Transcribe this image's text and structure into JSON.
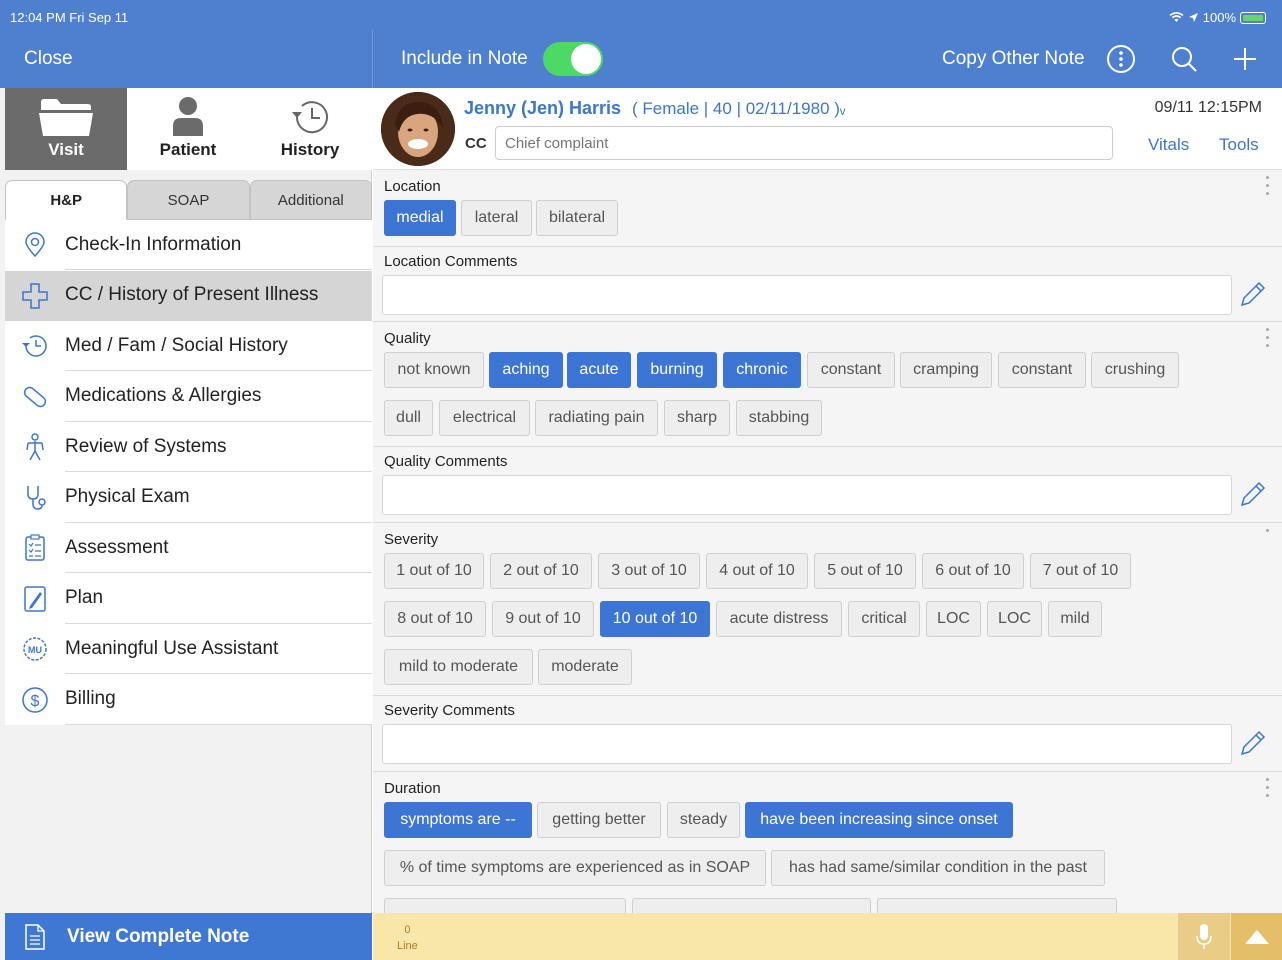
{
  "status": {
    "time": "12:04 PM  Fri Sep 11",
    "battery": "100%"
  },
  "topbar": {
    "close": "Close",
    "include_in_note": "Include in Note",
    "include_on": true,
    "copy_other_note": "Copy Other Note"
  },
  "sidebar": {
    "modes": [
      {
        "label": "Visit",
        "icon": "folder-icon",
        "active": true
      },
      {
        "label": "Patient",
        "icon": "person-icon",
        "active": false
      },
      {
        "label": "History",
        "icon": "history-icon",
        "active": false
      }
    ],
    "subtabs": [
      "H&P",
      "SOAP",
      "Additional"
    ],
    "items": [
      {
        "label": "Check-In Information",
        "icon": "location-pin-icon"
      },
      {
        "label": "CC / History of Present Illness",
        "icon": "medical-cross-icon",
        "active": true
      },
      {
        "label": "Med / Fam / Social History",
        "icon": "history-icon"
      },
      {
        "label": "Medications & Allergies",
        "icon": "pill-icon"
      },
      {
        "label": "Review of Systems",
        "icon": "body-icon"
      },
      {
        "label": "Physical Exam",
        "icon": "stethoscope-icon"
      },
      {
        "label": "Assessment",
        "icon": "clipboard-icon"
      },
      {
        "label": "Plan",
        "icon": "pen-note-icon"
      },
      {
        "label": "Meaningful Use Assistant",
        "icon": "mu-badge-icon"
      },
      {
        "label": "Billing",
        "icon": "dollar-icon"
      }
    ],
    "view_complete_note": "View Complete Note"
  },
  "patient": {
    "name": "Jenny (Jen) Harris",
    "info": "( Female | 40 | 02/11/1980 )ᵥ",
    "datetime": "09/11 12:15PM",
    "cc_label": "CC",
    "cc_placeholder": "Chief complaint",
    "vitals": "Vitals",
    "tools": "Tools"
  },
  "sections": {
    "location": {
      "title": "Location",
      "options": [
        "medial",
        "lateral",
        "bilateral"
      ]
    },
    "location_comments": "Location Comments",
    "quality": {
      "title": "Quality",
      "options": [
        "not known",
        "aching",
        "acute",
        "burning",
        "chronic",
        "constant",
        "cramping",
        "constant",
        "crushing",
        "dull",
        "electrical",
        "radiating pain",
        "sharp",
        "stabbing"
      ]
    },
    "quality_comments": "Quality Comments",
    "severity": {
      "title": "Severity",
      "options": [
        "1 out of 10",
        "2 out of 10",
        "3 out of 10",
        "4 out of 10",
        "5 out of 10",
        "6 out of 10",
        "7 out of 10",
        "8 out of 10",
        "9 out of 10",
        "10 out of 10",
        "acute distress",
        "critical",
        "LOC",
        "LOC",
        "mild",
        "mild to moderate",
        "moderate"
      ]
    },
    "severity_comments": "Severity Comments",
    "duration": {
      "title": "Duration",
      "options": [
        "symptoms are --",
        "getting better",
        "steady",
        "have been increasing since onset",
        "% of time symptoms are experienced as in SOAP",
        "has had same/similar condition in the past"
      ]
    }
  },
  "bottombar": {
    "count": "0",
    "unit": "Line"
  },
  "colors": {
    "accent": "#4f80cf",
    "selected": "#3c75d3",
    "toggle": "#4cd964",
    "bottombar": "#f9e6a9"
  }
}
